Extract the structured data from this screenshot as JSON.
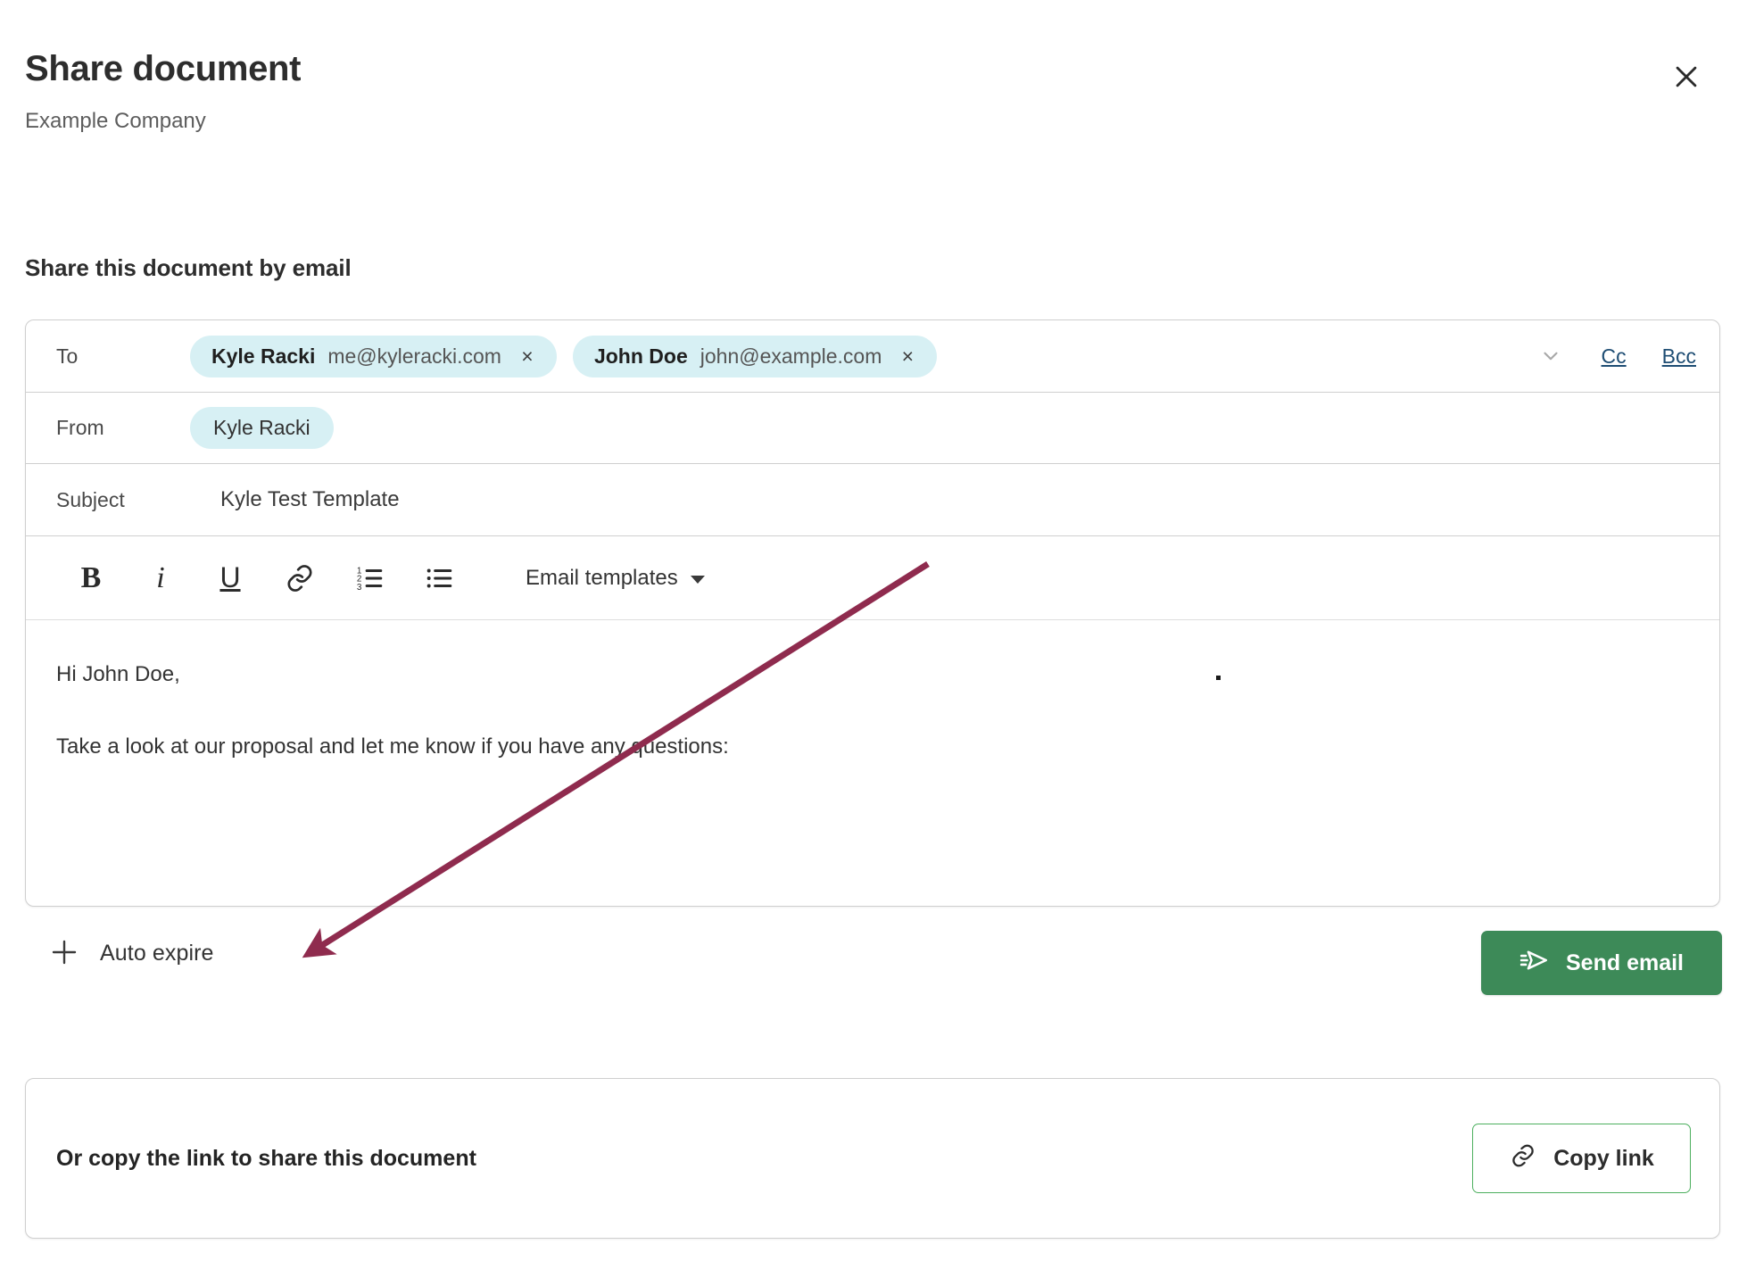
{
  "dialog": {
    "title": "Share document",
    "subtitle": "Example Company",
    "close_icon": "close-icon"
  },
  "section": {
    "heading": "Share this document by email"
  },
  "compose": {
    "to": {
      "label": "To",
      "recipients": [
        {
          "name": "Kyle Racki",
          "email": "me@kyleracki.com",
          "remove": "×"
        },
        {
          "name": "John Doe",
          "email": "john@example.com",
          "remove": "×"
        }
      ],
      "expand_icon": "chevron-down-icon",
      "cc_label": "Cc",
      "bcc_label": "Bcc"
    },
    "from": {
      "label": "From",
      "value": "Kyle Racki"
    },
    "subject": {
      "label": "Subject",
      "value": "Kyle Test Template",
      "placeholder": "Subject"
    },
    "toolbar": {
      "bold_label": "B",
      "italic_label": "i",
      "underline_label": "U",
      "link_icon": "link-icon",
      "ordered_list_icon": "numbered-list-icon",
      "bullet_list_icon": "bullet-list-icon",
      "templates_label": "Email templates",
      "templates_caret": "caret-down-icon"
    },
    "body": {
      "greeting": "Hi John Doe,",
      "paragraph": "Take a look at our proposal and let me know if you have any questions:"
    }
  },
  "actions": {
    "auto_expire_label": "Auto expire",
    "auto_expire_icon": "plus-icon",
    "send_email_label": "Send email",
    "send_email_icon": "send-icon"
  },
  "copy_link_section": {
    "text": "Or copy the link to share this document",
    "button_label": "Copy link",
    "button_icon": "link-chain-icon"
  },
  "colors": {
    "accent_green": "#3d8a58",
    "copy_link_border": "#4caf5e",
    "chip_background": "#d7f0f4",
    "link_blue": "#1e4d73",
    "annotation_arrow": "#8f2b4e",
    "text_primary": "#2d2d2d",
    "text_secondary": "#5d5d5d"
  },
  "annotation": {
    "arrow_color": "#8f2b4e",
    "description": "arrow pointing to Auto expire"
  }
}
